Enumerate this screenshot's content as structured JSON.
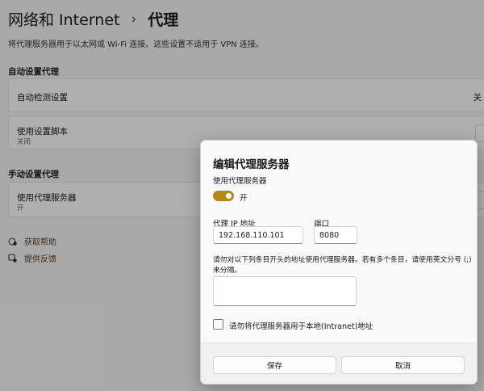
{
  "header": {
    "parent": "网络和 Internet",
    "separator": "›",
    "current": "代理"
  },
  "description": "将代理服务器用于以太网或 Wi-Fi 连接。这些设置不适用于 VPN 连接。",
  "auto_section": {
    "title": "自动设置代理",
    "auto_detect": {
      "label": "自动检测设置",
      "state": "关"
    },
    "setup_script": {
      "label": "使用设置脚本",
      "state": "关闭"
    }
  },
  "manual_section": {
    "title": "手动设置代理",
    "use_proxy": {
      "label": "使用代理服务器",
      "state": "开"
    }
  },
  "links": {
    "help": "获取帮助",
    "feedback": "提供反馈"
  },
  "dialog": {
    "title": "编辑代理服务器",
    "use_proxy_label": "使用代理服务器",
    "toggle_state": "开",
    "toggle_on": true,
    "ip_label": "代理 IP 地址",
    "ip_value": "192.168.110.101",
    "port_label": "端口",
    "port_value": "8080",
    "exceptions_hint": "请勿对以下列条目开头的地址使用代理服务器。若有多个条目，请使用英文分号 (;) 来分隔。",
    "exceptions_value": "",
    "local_checkbox_label": "请勿将代理服务器用于本地(Intranet)地址",
    "local_checked": false,
    "save_label": "保存",
    "cancel_label": "取消"
  },
  "colors": {
    "accent": "#b8861b",
    "background": "#f3f3f3",
    "link": "#5a3d1b"
  }
}
